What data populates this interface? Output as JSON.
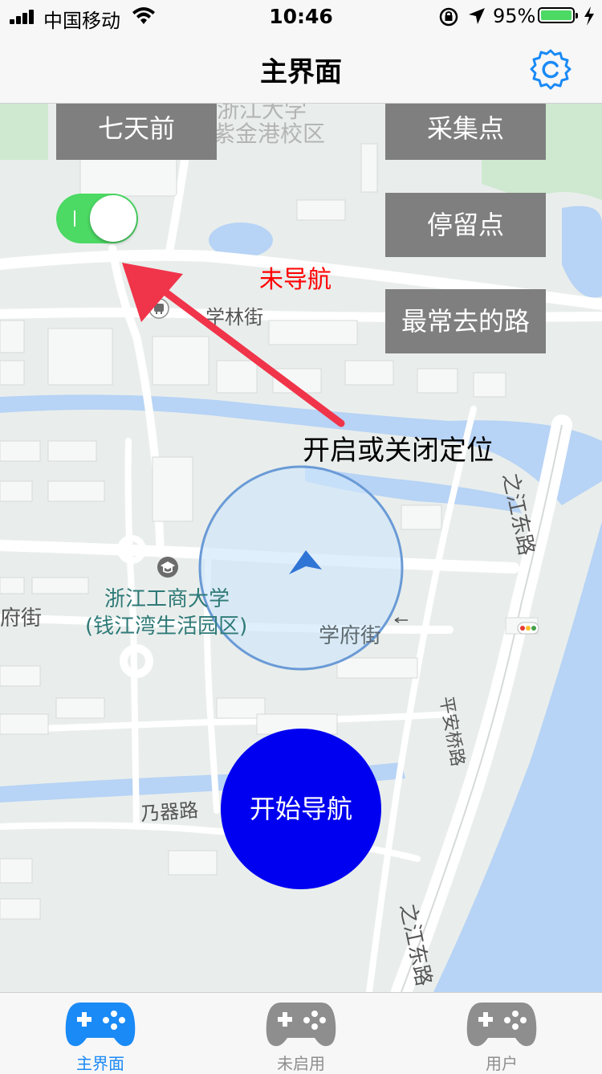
{
  "status_bar": {
    "carrier": "中国移动",
    "time": "10:46",
    "battery_percent": "95%",
    "battery_level": 0.95
  },
  "header": {
    "title": "主界面",
    "settings_icon": "gear-icon"
  },
  "map": {
    "buttons": {
      "seven_days_ago": "七天前",
      "collection_points": "采集点",
      "stay_points": "停留点",
      "frequent_routes": "最常去的路"
    },
    "location_toggle": {
      "on": true
    },
    "nav_status": "未导航",
    "annotation": "开启或关闭定位",
    "start_nav": "开始导航",
    "labels": {
      "campus_top_1": "浙江大学",
      "campus_top_2": "紫金港校区",
      "xuelin_street": "学林街",
      "university_1": "浙江工商大学",
      "university_2": "(钱江湾生活园区)",
      "xuefu_street": "学府街",
      "xuefu_street_left": "府街",
      "zhijiang_east_road": "之江东路",
      "pingan_bridge_road": "平安桥路",
      "naiqi_road": "乃器路"
    },
    "colors": {
      "button_bg": "#7f7f7f",
      "toggle_on": "#4cd964",
      "nav_status": "#ff0000",
      "start_nav_bg": "#0000f0",
      "arrow": "#f0344a",
      "water": "#b7d3f5",
      "park": "#cfe8d0"
    }
  },
  "tabbar": {
    "tabs": [
      {
        "label": "主界面",
        "icon": "gamepad-icon",
        "active": true
      },
      {
        "label": "未启用",
        "icon": "gamepad-icon",
        "active": false
      },
      {
        "label": "用户",
        "icon": "gamepad-icon",
        "active": false
      }
    ],
    "active_color": "#1a8af6",
    "inactive_color": "#8e8e8e"
  }
}
